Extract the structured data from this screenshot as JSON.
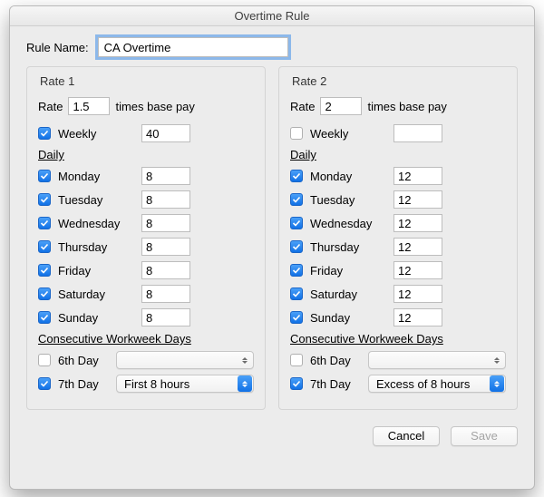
{
  "window": {
    "title": "Overtime Rule"
  },
  "labels": {
    "rule_name": "Rule Name:",
    "rate": "Rate",
    "times_base_pay": "times base pay",
    "weekly": "Weekly",
    "daily": "Daily",
    "consecutive": "Consecutive Workweek Days",
    "sixth_day": "6th Day",
    "seventh_day": "7th Day"
  },
  "rule_name_value": "CA Overtime",
  "rate1": {
    "title": "Rate 1",
    "rate_value": "1.5",
    "weekly_checked": true,
    "weekly_value": "40",
    "days": [
      {
        "name": "Monday",
        "checked": true,
        "value": "8"
      },
      {
        "name": "Tuesday",
        "checked": true,
        "value": "8"
      },
      {
        "name": "Wednesday",
        "checked": true,
        "value": "8"
      },
      {
        "name": "Thursday",
        "checked": true,
        "value": "8"
      },
      {
        "name": "Friday",
        "checked": true,
        "value": "8"
      },
      {
        "name": "Saturday",
        "checked": true,
        "value": "8"
      },
      {
        "name": "Sunday",
        "checked": true,
        "value": "8"
      }
    ],
    "sixth_checked": false,
    "sixth_value": "",
    "seventh_checked": true,
    "seventh_value": "First 8 hours"
  },
  "rate2": {
    "title": "Rate 2",
    "rate_value": "2",
    "weekly_checked": false,
    "weekly_value": "",
    "days": [
      {
        "name": "Monday",
        "checked": true,
        "value": "12"
      },
      {
        "name": "Tuesday",
        "checked": true,
        "value": "12"
      },
      {
        "name": "Wednesday",
        "checked": true,
        "value": "12"
      },
      {
        "name": "Thursday",
        "checked": true,
        "value": "12"
      },
      {
        "name": "Friday",
        "checked": true,
        "value": "12"
      },
      {
        "name": "Saturday",
        "checked": true,
        "value": "12"
      },
      {
        "name": "Sunday",
        "checked": true,
        "value": "12"
      }
    ],
    "sixth_checked": false,
    "sixth_value": "",
    "seventh_checked": true,
    "seventh_value": "Excess of 8 hours"
  },
  "buttons": {
    "cancel": "Cancel",
    "save": "Save"
  }
}
